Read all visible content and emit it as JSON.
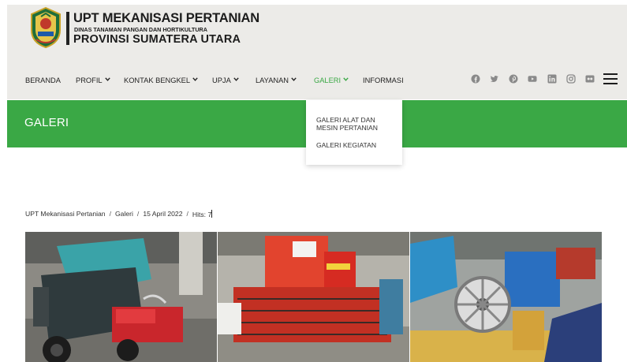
{
  "brand": {
    "title": "UPT MEKANISASI PERTANIAN",
    "subtitle": "DINAS TANAMAN PANGAN DAN HORTIKULTURA",
    "province": "PROVINSI SUMATERA UTARA"
  },
  "nav": {
    "items": [
      {
        "label": "BERANDA",
        "has_dropdown": false
      },
      {
        "label": "PROFIL",
        "has_dropdown": true
      },
      {
        "label": "KONTAK BENGKEL",
        "has_dropdown": true
      },
      {
        "label": "UPJA",
        "has_dropdown": true
      },
      {
        "label": "LAYANAN",
        "has_dropdown": true
      },
      {
        "label": "GALERI",
        "has_dropdown": true,
        "active": true
      },
      {
        "label": "INFORMASI",
        "has_dropdown": false
      }
    ],
    "active_color": "#3aa845",
    "chevron": "⌄"
  },
  "social_icons": [
    "facebook-icon",
    "twitter-icon",
    "pinterest-icon",
    "youtube-icon",
    "linkedin-icon",
    "instagram-icon",
    "flickr-icon"
  ],
  "dropdown": {
    "items": [
      {
        "label_line1": "GALERI ALAT DAN",
        "label_line2": "MESIN PERTANIAN"
      },
      {
        "label_line1": "GALERI KEGIATAN",
        "label_line2": ""
      }
    ]
  },
  "page_heading": "GALERI",
  "theme": {
    "green": "#3aa845",
    "header_bg": "#ecebe8"
  },
  "breadcrumb": {
    "site": "UPT Mekanisasi Pertanian",
    "section": "Galeri",
    "date": "15 April 2022",
    "hits_label": "Hits:",
    "hits_value": "7",
    "separator": "/"
  },
  "photos": [
    {
      "subject": "thresher-machine-photo"
    },
    {
      "subject": "combine-harvester-photo"
    },
    {
      "subject": "pulley-machine-photo"
    }
  ]
}
